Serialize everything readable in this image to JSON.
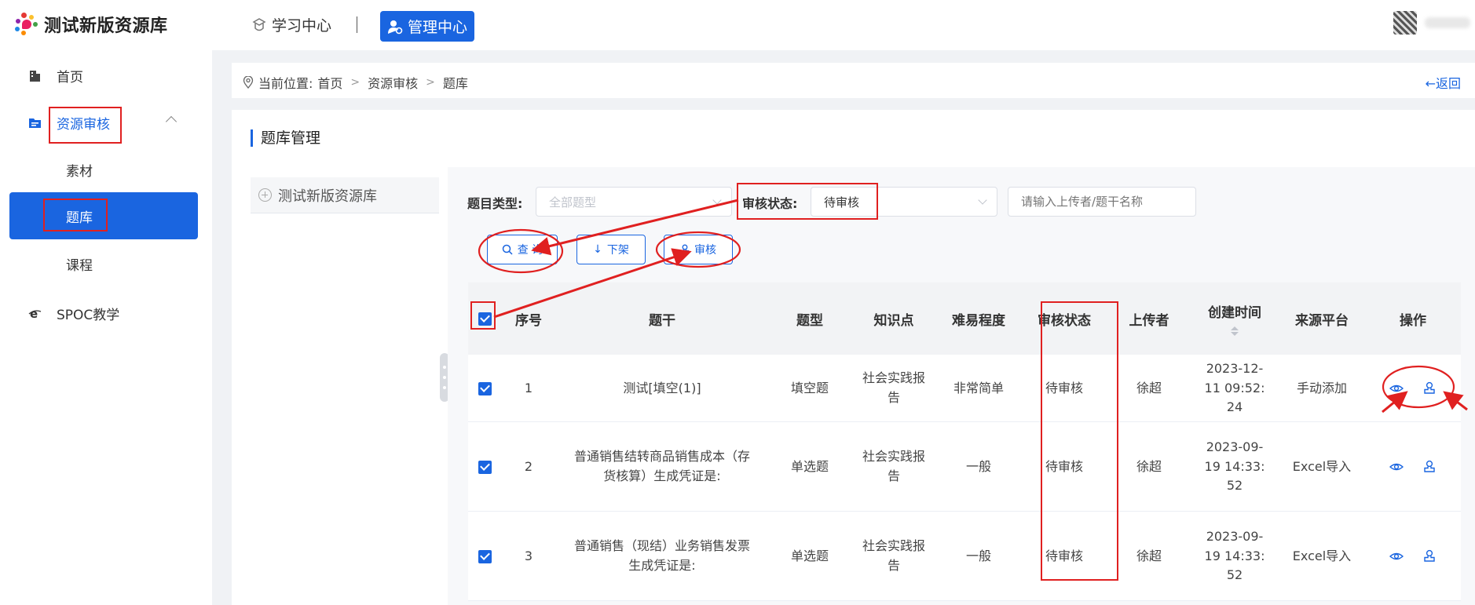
{
  "header": {
    "brand": "测试新版资源库",
    "nav_study": "学习中心",
    "nav_admin": "管理中心"
  },
  "sidebar": {
    "items": [
      {
        "label": "首页"
      },
      {
        "label": "资源审核"
      },
      {
        "label": "素材"
      },
      {
        "label": "题库"
      },
      {
        "label": "课程"
      },
      {
        "label": "SPOC教学"
      }
    ]
  },
  "breadcrumb": {
    "prefix": "当前位置:",
    "items": [
      "首页",
      "资源审核",
      "题库"
    ],
    "back": "←返回"
  },
  "main": {
    "section_title": "题库管理",
    "tree_root": "测试新版资源库"
  },
  "filters": {
    "type_label": "题目类型:",
    "type_placeholder": "全部题型",
    "status_label": "审核状态:",
    "status_value": "待审核",
    "search_placeholder": "请输入上传者/题干名称"
  },
  "buttons": {
    "query": "查 询",
    "offshelf": "下架",
    "review": "审核"
  },
  "table": {
    "headers": {
      "index": "序号",
      "stem": "题干",
      "type": "题型",
      "knowledge": "知识点",
      "difficulty": "难易程度",
      "status": "审核状态",
      "uploader": "上传者",
      "created": "创建时间",
      "source": "来源平台",
      "ops": "操作"
    },
    "rows": [
      {
        "index": "1",
        "stem": "测试[填空(1)]",
        "type": "填空题",
        "knowledge": "社会实践报告",
        "difficulty": "非常简单",
        "status": "待审核",
        "uploader": "徐超",
        "created": "2023-12-11 09:52:24",
        "source": "手动添加"
      },
      {
        "index": "2",
        "stem": "普通销售结转商品销售成本（存货核算）生成凭证是:",
        "type": "单选题",
        "knowledge": "社会实践报告",
        "difficulty": "一般",
        "status": "待审核",
        "uploader": "徐超",
        "created": "2023-09-19 14:33:52",
        "source": "Excel导入"
      },
      {
        "index": "3",
        "stem": "普通销售（现结）业务销售发票生成凭证是:",
        "type": "单选题",
        "knowledge": "社会实践报告",
        "difficulty": "一般",
        "status": "待审核",
        "uploader": "徐超",
        "created": "2023-09-19 14:33:52",
        "source": "Excel导入"
      }
    ]
  },
  "colors": {
    "primary": "#1a65e0",
    "annotation": "#e02020"
  }
}
